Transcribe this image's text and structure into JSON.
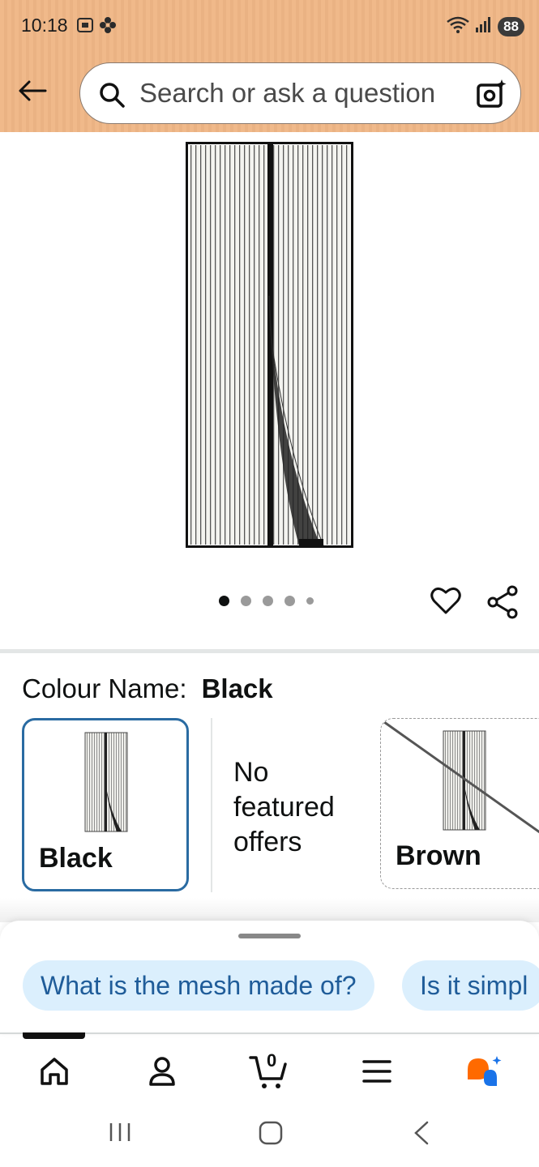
{
  "status_bar": {
    "time": "10:18",
    "battery": "88"
  },
  "search": {
    "placeholder": "Search or ask a question"
  },
  "product": {
    "image_alt": "Black magnetic screen door",
    "carousel": {
      "count": 5,
      "active_index": 0
    }
  },
  "variation": {
    "label": "Colour Name:",
    "selected": "Black",
    "options": [
      {
        "name": "Black",
        "selected": true,
        "available": true
      },
      {
        "name": "Brown",
        "selected": false,
        "available": false
      }
    ],
    "no_offers_text": "No featured offers"
  },
  "suggestions": {
    "chips": [
      "What is the mesh made of?",
      "Is it simpl"
    ]
  },
  "bottom_nav": {
    "items": [
      "home-icon",
      "account-icon",
      "cart-icon",
      "menu-icon",
      "rufus-icon"
    ],
    "cart_count": "0"
  },
  "colors": {
    "accent": "#2a6ba2",
    "chip_bg": "#dbeffd",
    "chip_text": "#1f5c99",
    "header": "#f0b98a"
  }
}
